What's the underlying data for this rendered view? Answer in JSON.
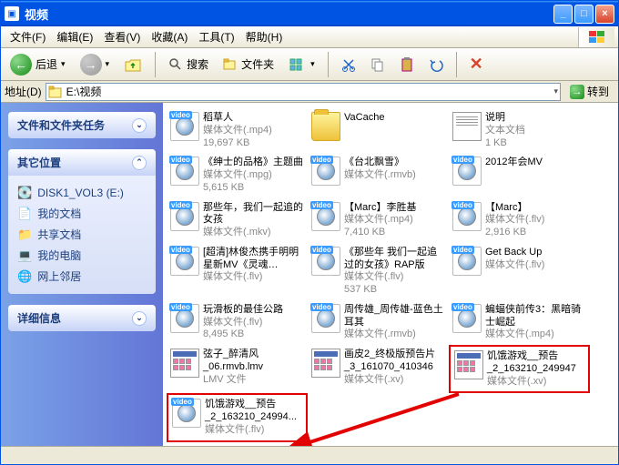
{
  "window": {
    "title": "视频",
    "min": "_",
    "max": "□",
    "close": "×"
  },
  "menu": {
    "file": "文件(F)",
    "edit": "编辑(E)",
    "view": "查看(V)",
    "fav": "收藏(A)",
    "tools": "工具(T)",
    "help": "帮助(H)"
  },
  "toolbar": {
    "back": "后退",
    "search": "搜索",
    "folders": "文件夹"
  },
  "address": {
    "label": "地址(D)",
    "path": "E:\\视频",
    "go": "转到"
  },
  "sidebar": {
    "tasks": {
      "title": "文件和文件夹任务"
    },
    "places": {
      "title": "其它位置",
      "items": [
        "DISK1_VOL3 (E:)",
        "我的文档",
        "共享文档",
        "我的电脑",
        "网上邻居"
      ]
    },
    "details": {
      "title": "详细信息"
    }
  },
  "badge": "video",
  "files": [
    {
      "name": "稻草人",
      "meta": "媒体文件(.mp4)",
      "size": "19,697 KB",
      "t": "v"
    },
    {
      "name": "VaCache",
      "meta": "",
      "size": "",
      "t": "f"
    },
    {
      "name": "说明",
      "meta": "文本文档",
      "size": "1 KB",
      "t": "txt"
    },
    {
      "name": "《绅士的品格》主题曲",
      "meta": "媒体文件(.mpg)",
      "size": "5,615 KB",
      "t": "v"
    },
    {
      "name": "《台北飘雪》",
      "meta": "媒体文件(.rmvb)",
      "size": "",
      "t": "v"
    },
    {
      "name": "2012年会MV",
      "meta": "",
      "size": "",
      "t": "v"
    },
    {
      "name": "那些年，我们一起追的女孩",
      "meta": "媒体文件(.mkv)",
      "size": "",
      "t": "v"
    },
    {
      "name": "【Marc】李胜基",
      "meta": "媒体文件(.mp4)",
      "size": "7,410 KB",
      "t": "v"
    },
    {
      "name": "【Marc】",
      "meta": "媒体文件(.flv)",
      "size": "2,916 KB",
      "t": "v"
    },
    {
      "name": "[超清]林俊杰携手明明星新MV《灵魂…",
      "meta": "媒体文件(.flv)",
      "size": "",
      "t": "v"
    },
    {
      "name": "《那些年 我们一起追过的女孩》RAP版",
      "meta": "媒体文件(.flv)",
      "size": "537 KB",
      "t": "v"
    },
    {
      "name": "Get Back Up",
      "meta": "媒体文件(.flv)",
      "size": "",
      "t": "v"
    },
    {
      "name": "玩滑板的最佳公路",
      "meta": "媒体文件(.flv)",
      "size": "8,495 KB",
      "t": "v"
    },
    {
      "name": "周传雄_周传雄-蓝色土耳其",
      "meta": "媒体文件(.rmvb)",
      "size": "",
      "t": "v"
    },
    {
      "name": "蝙蝠侠前传3：黑暗骑士崛起",
      "meta": "媒体文件(.mp4)",
      "size": "",
      "t": "v"
    },
    {
      "name": "弦子_醉清风_06.rmvb.lmv",
      "meta": "LMV 文件",
      "size": "",
      "t": "xv"
    },
    {
      "name": "画皮2_终极版预告片_3_161070_410346",
      "meta": "媒体文件(.xv)",
      "size": "",
      "t": "xv"
    },
    {
      "name": "饥饿游戏__预告_2_163210_249947",
      "meta": "媒体文件(.xv)",
      "size": "",
      "t": "xv",
      "hl": true
    },
    {
      "name": "饥饿游戏__预告_2_163210_24994...",
      "meta": "媒体文件(.flv)",
      "size": "",
      "t": "v",
      "hl": true
    }
  ]
}
